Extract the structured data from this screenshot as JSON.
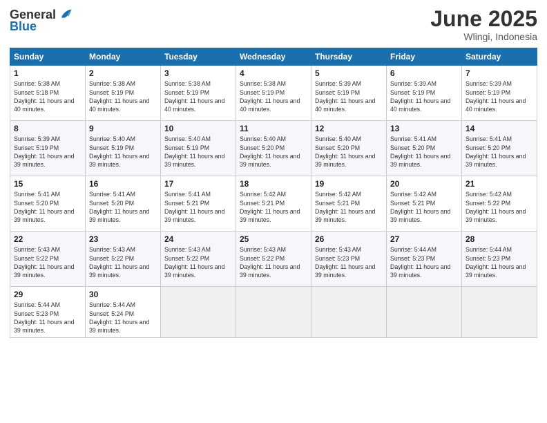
{
  "header": {
    "logo_general": "General",
    "logo_blue": "Blue",
    "month": "June 2025",
    "location": "Wlingi, Indonesia"
  },
  "weekdays": [
    "Sunday",
    "Monday",
    "Tuesday",
    "Wednesday",
    "Thursday",
    "Friday",
    "Saturday"
  ],
  "weeks": [
    [
      {
        "day": "1",
        "sunrise": "5:38 AM",
        "sunset": "5:18 PM",
        "daylight": "11 hours and 40 minutes."
      },
      {
        "day": "2",
        "sunrise": "5:38 AM",
        "sunset": "5:19 PM",
        "daylight": "11 hours and 40 minutes."
      },
      {
        "day": "3",
        "sunrise": "5:38 AM",
        "sunset": "5:19 PM",
        "daylight": "11 hours and 40 minutes."
      },
      {
        "day": "4",
        "sunrise": "5:38 AM",
        "sunset": "5:19 PM",
        "daylight": "11 hours and 40 minutes."
      },
      {
        "day": "5",
        "sunrise": "5:39 AM",
        "sunset": "5:19 PM",
        "daylight": "11 hours and 40 minutes."
      },
      {
        "day": "6",
        "sunrise": "5:39 AM",
        "sunset": "5:19 PM",
        "daylight": "11 hours and 40 minutes."
      },
      {
        "day": "7",
        "sunrise": "5:39 AM",
        "sunset": "5:19 PM",
        "daylight": "11 hours and 40 minutes."
      }
    ],
    [
      {
        "day": "8",
        "sunrise": "5:39 AM",
        "sunset": "5:19 PM",
        "daylight": "11 hours and 39 minutes."
      },
      {
        "day": "9",
        "sunrise": "5:40 AM",
        "sunset": "5:19 PM",
        "daylight": "11 hours and 39 minutes."
      },
      {
        "day": "10",
        "sunrise": "5:40 AM",
        "sunset": "5:19 PM",
        "daylight": "11 hours and 39 minutes."
      },
      {
        "day": "11",
        "sunrise": "5:40 AM",
        "sunset": "5:20 PM",
        "daylight": "11 hours and 39 minutes."
      },
      {
        "day": "12",
        "sunrise": "5:40 AM",
        "sunset": "5:20 PM",
        "daylight": "11 hours and 39 minutes."
      },
      {
        "day": "13",
        "sunrise": "5:41 AM",
        "sunset": "5:20 PM",
        "daylight": "11 hours and 39 minutes."
      },
      {
        "day": "14",
        "sunrise": "5:41 AM",
        "sunset": "5:20 PM",
        "daylight": "11 hours and 39 minutes."
      }
    ],
    [
      {
        "day": "15",
        "sunrise": "5:41 AM",
        "sunset": "5:20 PM",
        "daylight": "11 hours and 39 minutes."
      },
      {
        "day": "16",
        "sunrise": "5:41 AM",
        "sunset": "5:20 PM",
        "daylight": "11 hours and 39 minutes."
      },
      {
        "day": "17",
        "sunrise": "5:41 AM",
        "sunset": "5:21 PM",
        "daylight": "11 hours and 39 minutes."
      },
      {
        "day": "18",
        "sunrise": "5:42 AM",
        "sunset": "5:21 PM",
        "daylight": "11 hours and 39 minutes."
      },
      {
        "day": "19",
        "sunrise": "5:42 AM",
        "sunset": "5:21 PM",
        "daylight": "11 hours and 39 minutes."
      },
      {
        "day": "20",
        "sunrise": "5:42 AM",
        "sunset": "5:21 PM",
        "daylight": "11 hours and 39 minutes."
      },
      {
        "day": "21",
        "sunrise": "5:42 AM",
        "sunset": "5:22 PM",
        "daylight": "11 hours and 39 minutes."
      }
    ],
    [
      {
        "day": "22",
        "sunrise": "5:43 AM",
        "sunset": "5:22 PM",
        "daylight": "11 hours and 39 minutes."
      },
      {
        "day": "23",
        "sunrise": "5:43 AM",
        "sunset": "5:22 PM",
        "daylight": "11 hours and 39 minutes."
      },
      {
        "day": "24",
        "sunrise": "5:43 AM",
        "sunset": "5:22 PM",
        "daylight": "11 hours and 39 minutes."
      },
      {
        "day": "25",
        "sunrise": "5:43 AM",
        "sunset": "5:22 PM",
        "daylight": "11 hours and 39 minutes."
      },
      {
        "day": "26",
        "sunrise": "5:43 AM",
        "sunset": "5:23 PM",
        "daylight": "11 hours and 39 minutes."
      },
      {
        "day": "27",
        "sunrise": "5:44 AM",
        "sunset": "5:23 PM",
        "daylight": "11 hours and 39 minutes."
      },
      {
        "day": "28",
        "sunrise": "5:44 AM",
        "sunset": "5:23 PM",
        "daylight": "11 hours and 39 minutes."
      }
    ],
    [
      {
        "day": "29",
        "sunrise": "5:44 AM",
        "sunset": "5:23 PM",
        "daylight": "11 hours and 39 minutes."
      },
      {
        "day": "30",
        "sunrise": "5:44 AM",
        "sunset": "5:24 PM",
        "daylight": "11 hours and 39 minutes."
      },
      null,
      null,
      null,
      null,
      null
    ]
  ]
}
